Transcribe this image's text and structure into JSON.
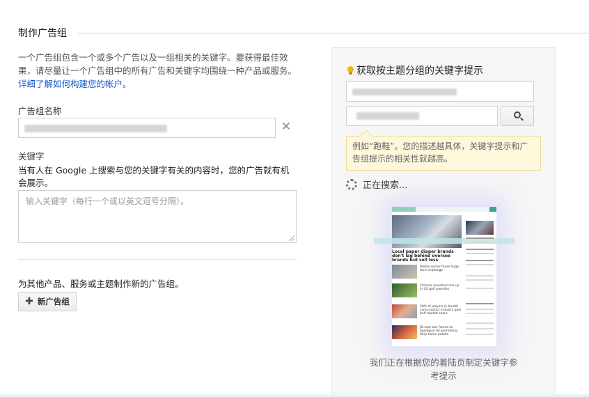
{
  "section": {
    "title": "制作广告组"
  },
  "description": {
    "text": "一个广告组包含一个或多个广告以及一组相关的关键字。要获得最佳效果，请尽量让一个广告组中的所有广告和关键字均围绕一种产品或服务。",
    "link": "详细了解如何构建您的帐户。"
  },
  "ad_group_name": {
    "label": "广告组名称",
    "value": ""
  },
  "keywords": {
    "label": "关键字",
    "help": "当有人在 Google 上搜索与您的关键字有关的内容时，您的广告就有机会展示。",
    "placeholder": "输入关键字（每行一个或以英文逗号分隔）。"
  },
  "other": {
    "text": "为其他产品、服务或主题制作新的广告组。"
  },
  "new_group_button": {
    "label": "新广告组",
    "icon": "plus-icon"
  },
  "panel": {
    "title": "获取按主题分组的关键字提示",
    "title_icon": "lightbulb-icon",
    "search_icon": "search-icon",
    "tip": "例如“跑鞋”。您的描述越具体，关键字提示和广告组提示的相关性就越高。",
    "status": "正在搜索...",
    "caption": "我们正在根据您的着陆页制定关键字参考提示",
    "mock": {
      "headline": "Local paper diaper brands don't lag behind oversee brands but sell less",
      "rows": [
        "Textile sector faces huge tech challenge",
        "Chinese investors line up in US golf provides",
        "20% of players in health care product industry gain half market share",
        "JD.com war forced to apologize for promoting fairy home outlets"
      ]
    }
  },
  "colors": {
    "link": "#1155cc",
    "tip_bg": "#fdf7dc",
    "panel_bg": "#f6f6f6",
    "bulb": "#f5b400"
  }
}
